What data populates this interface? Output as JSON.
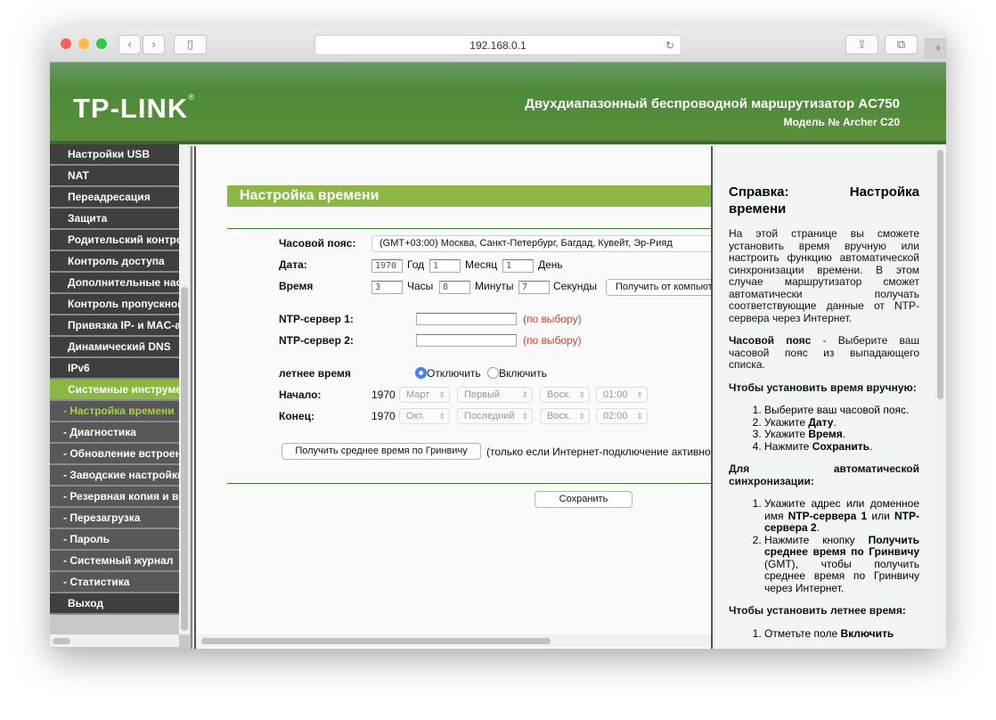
{
  "browser": {
    "url": "192.168.0.1"
  },
  "header": {
    "logo": "TP-LINK",
    "title": "Двухдиапазонный беспроводной маршрутизатор AC750",
    "model": "Модель № Archer C20"
  },
  "sidebar": {
    "items": [
      {
        "label": "Настройки USB",
        "type": "main"
      },
      {
        "label": "NAT",
        "type": "main"
      },
      {
        "label": "Переадресация",
        "type": "main"
      },
      {
        "label": "Защита",
        "type": "main"
      },
      {
        "label": "Родительский контроль",
        "type": "main"
      },
      {
        "label": "Контроль доступа",
        "type": "main"
      },
      {
        "label": "Дополнительные настройки маршрутизации",
        "type": "main"
      },
      {
        "label": "Контроль пропускной способности",
        "type": "main"
      },
      {
        "label": "Привязка IP- и MAC-адресов",
        "type": "main"
      },
      {
        "label": "Динамический DNS",
        "type": "main"
      },
      {
        "label": "IPv6",
        "type": "main"
      },
      {
        "label": "Системные инструменты",
        "type": "active"
      },
      {
        "label": "- Настройка времени",
        "type": "current"
      },
      {
        "label": "- Диагностика",
        "type": "sub"
      },
      {
        "label": "- Обновление встроенного ПО",
        "type": "sub"
      },
      {
        "label": "- Заводские настройки",
        "type": "sub"
      },
      {
        "label": "- Резервная копия и восстановление",
        "type": "sub"
      },
      {
        "label": "- Перезагрузка",
        "type": "sub"
      },
      {
        "label": "- Пароль",
        "type": "sub"
      },
      {
        "label": "- Системный журнал",
        "type": "sub"
      },
      {
        "label": "- Статистика",
        "type": "sub"
      },
      {
        "label": "Выход",
        "type": "main"
      }
    ]
  },
  "main": {
    "title": "Настройка времени",
    "timezone_label": "Часовой пояс:",
    "timezone_value": "(GMT+03:00) Москва, Санкт-Петербург, Багдад, Кувейт, Эр-Рияд",
    "date_label": "Дата:",
    "year": "1970",
    "year_unit": "Год",
    "month": "1",
    "month_unit": "Месяц",
    "day": "1",
    "day_unit": "День",
    "time_label": "Время",
    "hours": "3",
    "hours_unit": "Часы",
    "minutes": "8",
    "minutes_unit": "Минуты",
    "seconds": "7",
    "seconds_unit": "Секунды",
    "get_pc_time": "Получить от компьютера",
    "ntp1_label": "NTP-сервер 1:",
    "ntp2_label": "NTP-сервер 2:",
    "optional": "(по выбору)",
    "dst_label": "летнее время",
    "dst_off": "Отключить",
    "dst_on": "Включить",
    "start_label": "Начало:",
    "start_year": "1970",
    "start_month": "Март",
    "start_week": "Первый",
    "start_day": "Воск.",
    "start_time": "01:00",
    "end_label": "Конец:",
    "end_year": "1970",
    "end_month": "Окт.",
    "end_week": "Последний",
    "end_day": "Воск.",
    "end_time": "02:00",
    "gmt_button": "Получить среднее время по Гринвичу",
    "gmt_note": "(только если Интернет-подключение активно)",
    "save": "Сохранить"
  },
  "help": {
    "title": "Справка: Настройка времени",
    "intro": "На этой странице вы сможете установить время вручную или настроить функцию автоматической синхронизации времени. В этом случае маршрутизатор сможет автоматически получать соответствующие данные от NTP-сервера через Интернет.",
    "tz_bold": "Часовой пояс",
    "tz_text": " - Выберите ваш часовой пояс из выпадающего списка.",
    "manual_title": "Чтобы установить время вручную:",
    "manual_1": "Выберите ваш часовой пояс.",
    "manual_2a": "Укажите ",
    "manual_2b": "Дату",
    "manual_3a": "Укажите ",
    "manual_3b": "Время",
    "manual_4a": "Нажмите ",
    "manual_4b": "Сохранить",
    "auto_title": "Для автоматической синхронизации:",
    "auto_1a": "Укажите адрес или доменное имя ",
    "auto_1b": "NTP-сервера 1",
    "auto_1c": " или ",
    "auto_1d": "NTP-сервера 2",
    "auto_2a": "Нажмите кнопку ",
    "auto_2b": "Получить среднее время по Гринвичу",
    "auto_2c": " (GMT), чтобы получить среднее время по Гринвичу через Интернет.",
    "dst_title": "Чтобы установить летнее время:",
    "dst_1a": "Отметьте поле ",
    "dst_1b": "Включить"
  }
}
